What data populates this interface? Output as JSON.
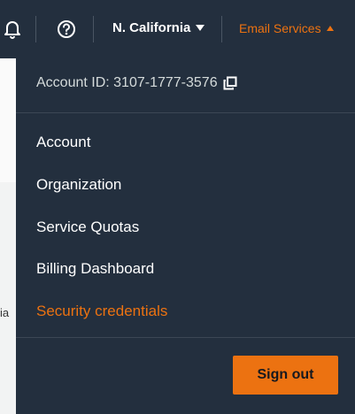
{
  "topbar": {
    "icons": {
      "notifications": "bell-icon",
      "help": "help-icon"
    },
    "region_label": "N. California",
    "account_menu_label": "Email Services",
    "colors": {
      "bar_bg": "#232f3e",
      "accent": "#ec7211"
    }
  },
  "dropdown": {
    "account_id_label": "Account ID: 3107-1777-3576",
    "copy_icon": "copy-icon",
    "items": [
      {
        "label": "Account"
      },
      {
        "label": "Organization"
      },
      {
        "label": "Service Quotas"
      },
      {
        "label": "Billing Dashboard"
      },
      {
        "label": "Security credentials"
      }
    ],
    "sign_out_label": "Sign out"
  },
  "page": {
    "fragment_text": "ia"
  }
}
